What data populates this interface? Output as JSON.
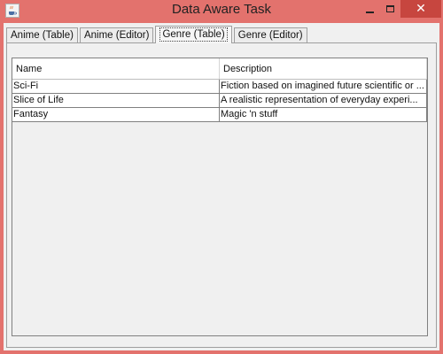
{
  "window": {
    "title": "Data Aware Task",
    "close_glyph": "✕"
  },
  "tabs": [
    {
      "label": "Anime (Table)"
    },
    {
      "label": "Anime (Editor)"
    },
    {
      "label": "Genre (Table)",
      "active": true
    },
    {
      "label": "Genre (Editor)"
    }
  ],
  "table": {
    "columns": [
      "Name",
      "Description"
    ],
    "rows": [
      {
        "name": "Sci-Fi",
        "description": "Fiction based on imagined future scientific or ..."
      },
      {
        "name": "Slice of Life",
        "description": "A realistic representation of everyday experi..."
      },
      {
        "name": "Fantasy",
        "description": "Magic 'n stuff"
      }
    ]
  }
}
